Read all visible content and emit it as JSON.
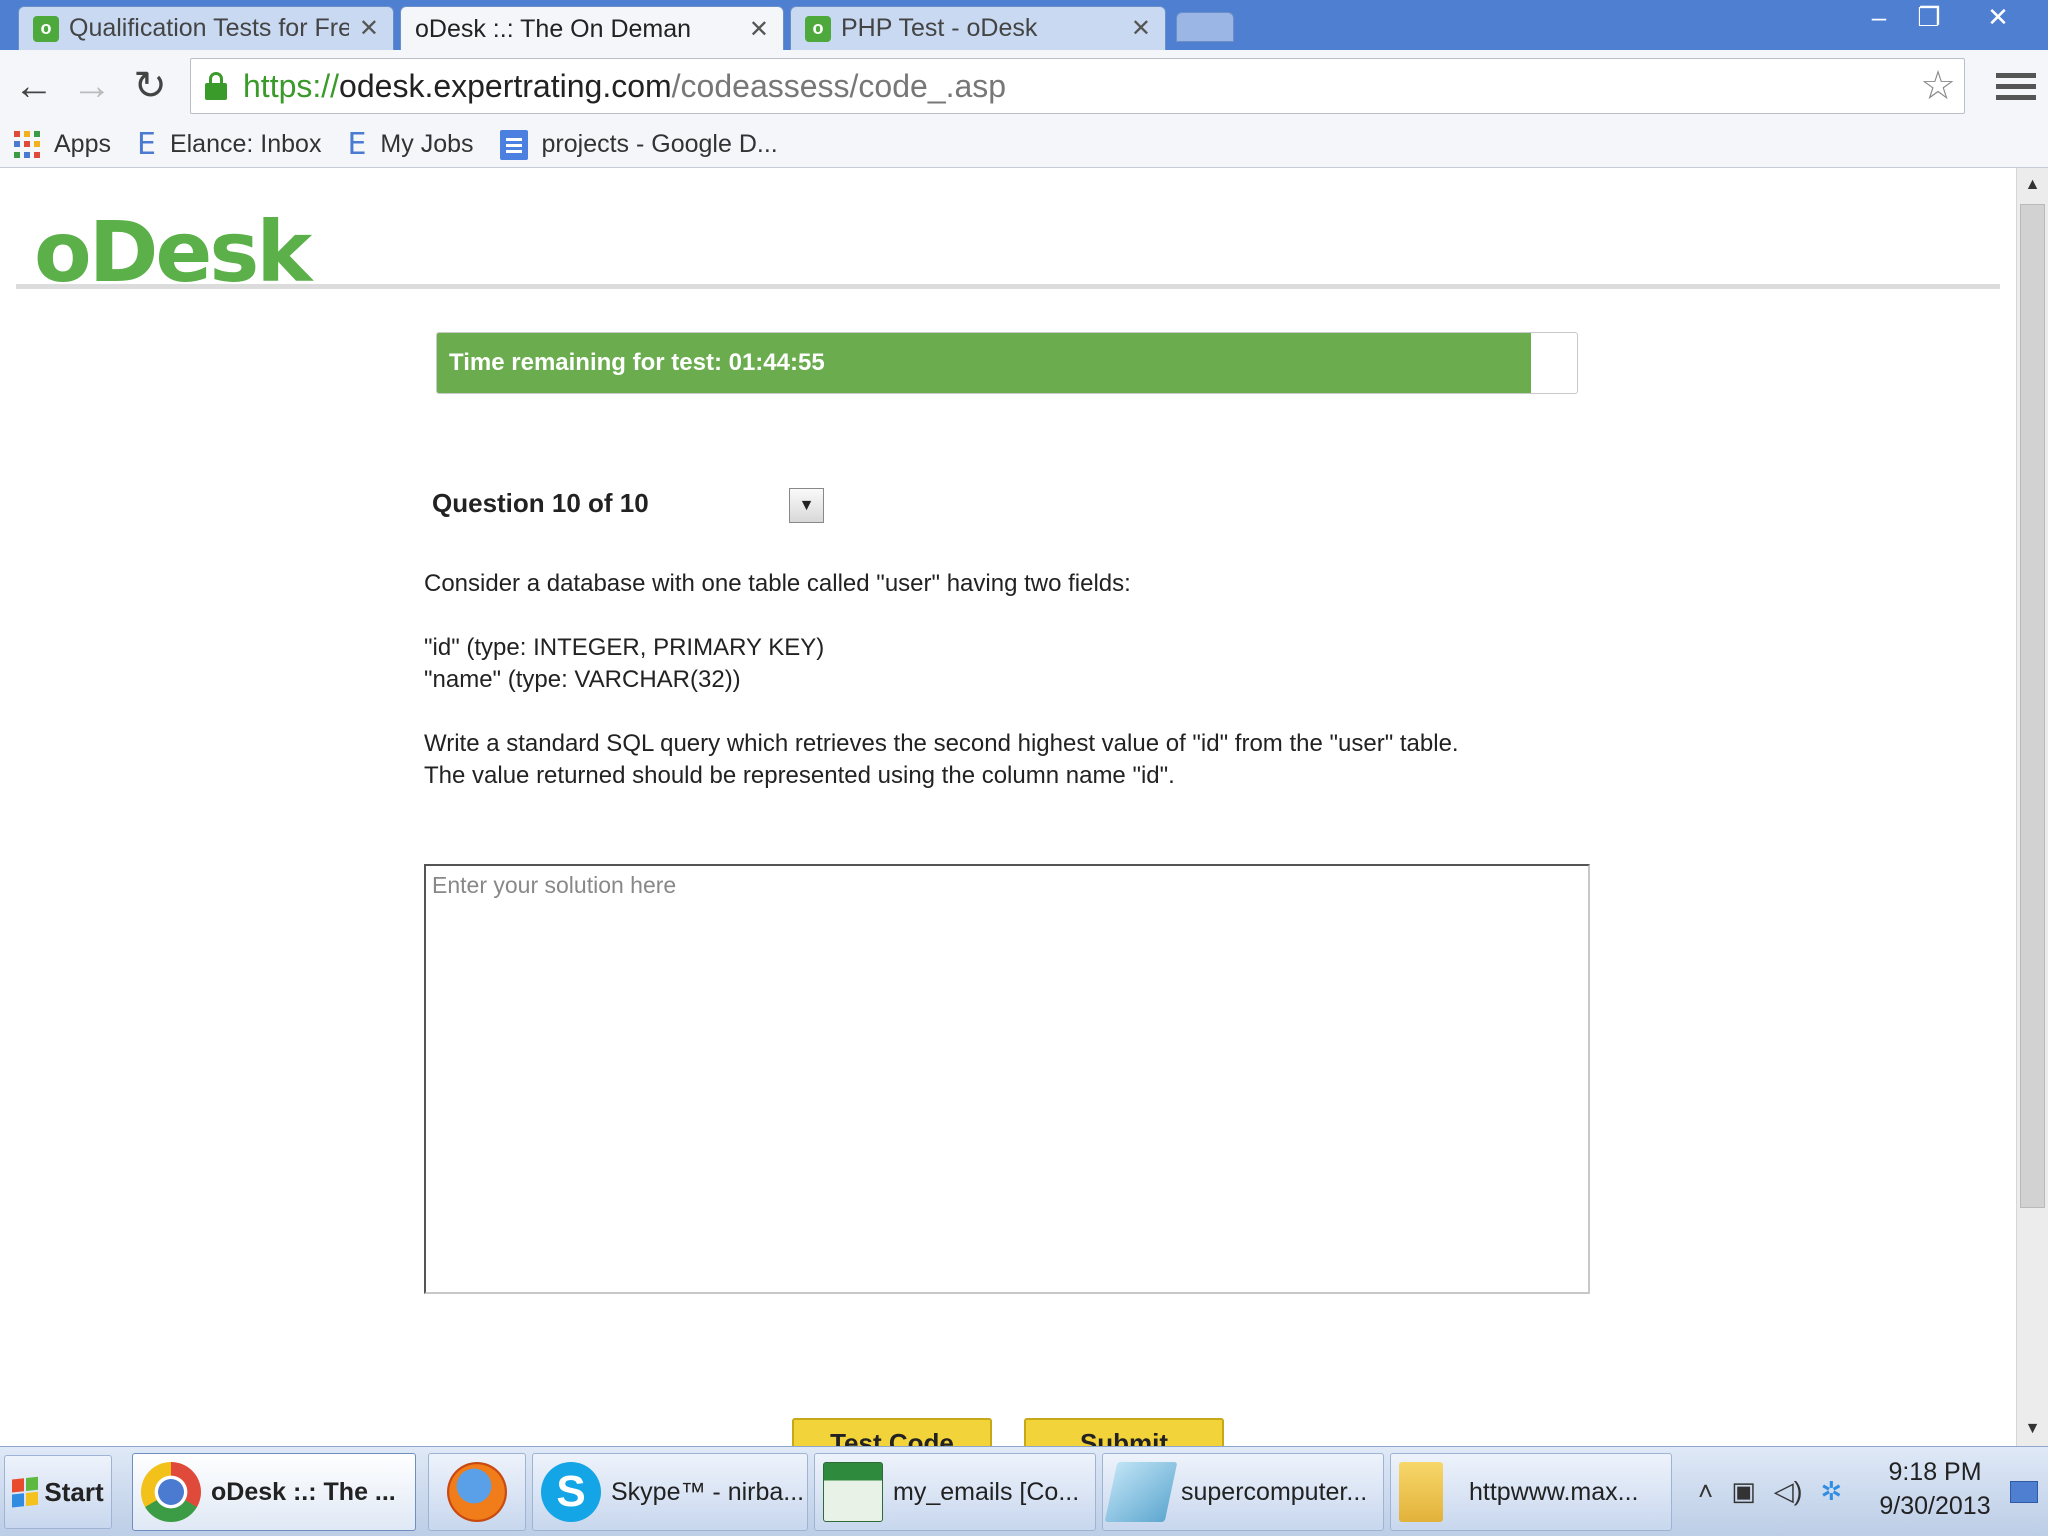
{
  "browser": {
    "tabs": [
      {
        "title": "Qualification Tests for Fre",
        "icon": "odesk-favicon",
        "active": false
      },
      {
        "title": "oDesk :.: The On Deman",
        "icon": "page-icon",
        "active": true
      },
      {
        "title": "PHP Test - oDesk",
        "icon": "odesk-favicon",
        "active": false
      }
    ],
    "url": {
      "scheme": "https://",
      "host": "odesk.expertrating.com",
      "path": "/codeassess/code_.asp"
    },
    "bookmarks": [
      {
        "label": "Apps",
        "icon": "apps-grid-icon"
      },
      {
        "label": "Elance: Inbox",
        "icon": "elance-icon"
      },
      {
        "label": "My Jobs",
        "icon": "elance-icon"
      },
      {
        "label": "projects - Google D...",
        "icon": "google-docs-icon"
      }
    ]
  },
  "page": {
    "logo": "oDesk",
    "timer": {
      "label": "Time remaining for test: 01:44:55",
      "progress_fraction": 0.96,
      "color": "#6aac4e"
    },
    "question_nav": "Question 10 of 10",
    "question": {
      "intro": "Consider a database with one table called \"user\" having two fields:",
      "field_id": "\"id\" (type: INTEGER, PRIMARY KEY)",
      "field_name": "\"name\" (type: VARCHAR(32))",
      "task_line1": "Write a standard SQL query which retrieves the second highest value of \"id\" from the \"user\" table.",
      "task_line2": "The value returned should be represented using the column name \"id\"."
    },
    "answer": {
      "placeholder": "Enter your solution here",
      "value": ""
    },
    "buttons": {
      "test_code": "Test Code",
      "submit": "Submit"
    }
  },
  "taskbar": {
    "start": "Start",
    "tasks": [
      {
        "label": "oDesk :.: The ...",
        "icon": "chrome-icon",
        "active": true
      },
      {
        "label": "",
        "icon": "firefox-icon",
        "active": false
      },
      {
        "label": "Skype™ - nirba...",
        "icon": "skype-icon",
        "active": false
      },
      {
        "label": "my_emails  [Co...",
        "icon": "excel-icon",
        "active": false
      },
      {
        "label": "supercomputer...",
        "icon": "notepad-icon",
        "active": false
      },
      {
        "label": "httpwww.max...",
        "icon": "folder-icon",
        "active": false
      }
    ],
    "clock_time": "9:18 PM",
    "clock_date": "9/30/2013"
  }
}
